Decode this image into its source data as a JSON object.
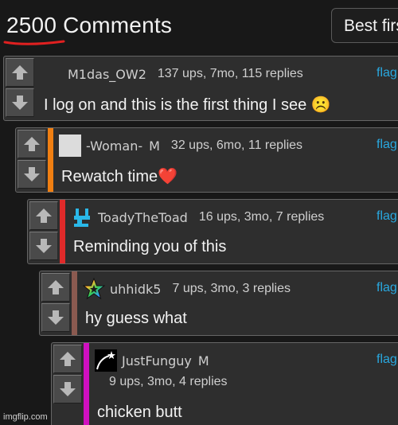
{
  "header": {
    "title": "2500 Comments",
    "sort_button": "Best first"
  },
  "comments": [
    {
      "user": "M1das_OW2",
      "badge": "",
      "meta": "137 ups, 7mo, 115 replies",
      "flag": "flag",
      "text": "I log on and this is the first thing I see ☹️"
    },
    {
      "user": "-Woman-",
      "badge": "M",
      "meta": "32 ups, 6mo, 11 replies",
      "flag": "flag",
      "text": "Rewatch time❤️"
    },
    {
      "user": "ToadyTheToad",
      "badge": "",
      "meta": "16 ups, 3mo, 7 replies",
      "flag": "flag",
      "text": "Reminding you of this"
    },
    {
      "user": "uhhidk5",
      "badge": "",
      "meta": "7 ups, 3mo, 3 replies",
      "flag": "flag",
      "text": "hy guess what"
    },
    {
      "user": "JustFunguy",
      "badge": "M",
      "meta": "9 ups, 3mo, 4 replies",
      "flag": "flag",
      "text": "chicken butt"
    }
  ],
  "colors": {
    "thread_bar_1": "#f07f12",
    "thread_bar_2": "#e02a2a",
    "thread_bar_3": "#8b5a50",
    "thread_bar_4": "#d010c0",
    "link": "#29a8e0",
    "underline": "#e02020"
  },
  "icons": [
    "up-arrow-icon",
    "down-arrow-icon"
  ],
  "watermark": "imgflip.com"
}
